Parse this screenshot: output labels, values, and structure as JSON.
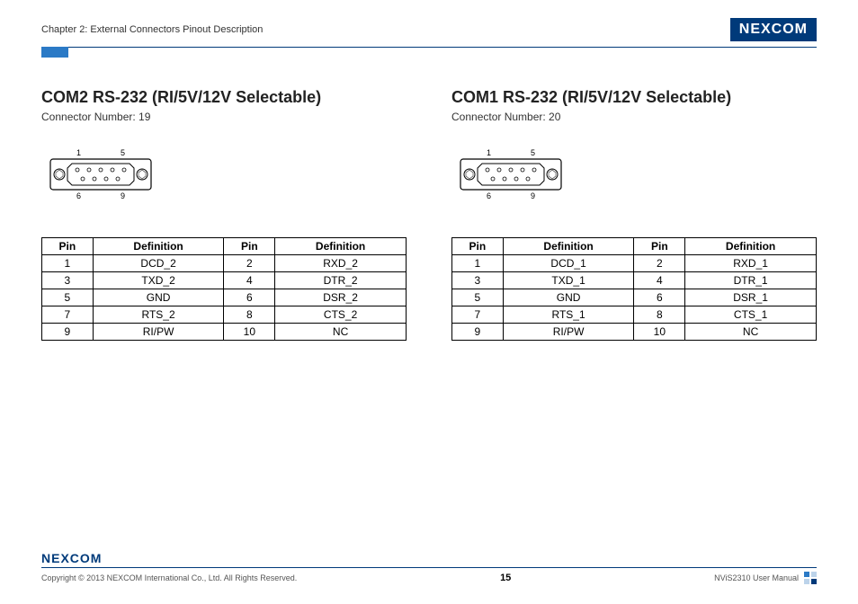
{
  "header": {
    "chapter": "Chapter 2: External Connectors Pinout Description",
    "brand": "NEXCOM"
  },
  "sections": [
    {
      "title": "COM2 RS-232 (RI/5V/12V Selectable)",
      "connector": "Connector Number: 19",
      "pinlabels": {
        "tl": "1",
        "tr": "5",
        "bl": "6",
        "br": "9"
      },
      "table": {
        "h_pin": "Pin",
        "h_def": "Definition",
        "rows": [
          {
            "p1": "1",
            "d1": "DCD_2",
            "p2": "2",
            "d2": "RXD_2"
          },
          {
            "p1": "3",
            "d1": "TXD_2",
            "p2": "4",
            "d2": "DTR_2"
          },
          {
            "p1": "5",
            "d1": "GND",
            "p2": "6",
            "d2": "DSR_2"
          },
          {
            "p1": "7",
            "d1": "RTS_2",
            "p2": "8",
            "d2": "CTS_2"
          },
          {
            "p1": "9",
            "d1": "RI/PW",
            "p2": "10",
            "d2": "NC"
          }
        ]
      }
    },
    {
      "title": "COM1 RS-232 (RI/5V/12V Selectable)",
      "connector": "Connector Number: 20",
      "pinlabels": {
        "tl": "1",
        "tr": "5",
        "bl": "6",
        "br": "9"
      },
      "table": {
        "h_pin": "Pin",
        "h_def": "Definition",
        "rows": [
          {
            "p1": "1",
            "d1": "DCD_1",
            "p2": "2",
            "d2": "RXD_1"
          },
          {
            "p1": "3",
            "d1": "TXD_1",
            "p2": "4",
            "d2": "DTR_1"
          },
          {
            "p1": "5",
            "d1": "GND",
            "p2": "6",
            "d2": "DSR_1"
          },
          {
            "p1": "7",
            "d1": "RTS_1",
            "p2": "8",
            "d2": "CTS_1"
          },
          {
            "p1": "9",
            "d1": "RI/PW",
            "p2": "10",
            "d2": "NC"
          }
        ]
      }
    }
  ],
  "footer": {
    "brand": "NEXCOM",
    "copyright": "Copyright © 2013 NEXCOM International Co., Ltd. All Rights Reserved.",
    "page": "15",
    "manual": "NViS2310 User Manual"
  }
}
